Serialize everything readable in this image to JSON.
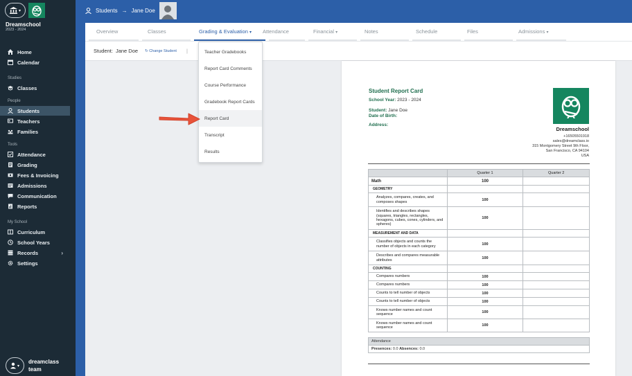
{
  "sidebar": {
    "school_name": "Dreamschool",
    "school_year": "2023 - 2024",
    "sections": {
      "studies": "Studies",
      "people": "People",
      "tools": "Tools",
      "my_school": "My School"
    },
    "items": [
      {
        "label": "Home",
        "icon": "home-icon"
      },
      {
        "label": "Calendar",
        "icon": "calendar-icon"
      },
      {
        "label": "Classes",
        "icon": "classes-icon"
      },
      {
        "label": "Students",
        "icon": "students-icon",
        "active": true
      },
      {
        "label": "Teachers",
        "icon": "teachers-icon"
      },
      {
        "label": "Families",
        "icon": "families-icon"
      },
      {
        "label": "Attendance",
        "icon": "attendance-icon"
      },
      {
        "label": "Grading",
        "icon": "grading-icon"
      },
      {
        "label": "Fees & Invoicing",
        "icon": "fees-icon"
      },
      {
        "label": "Admissions",
        "icon": "admissions-icon"
      },
      {
        "label": "Communication",
        "icon": "communication-icon"
      },
      {
        "label": "Reports",
        "icon": "reports-icon"
      },
      {
        "label": "Curriculum",
        "icon": "curriculum-icon"
      },
      {
        "label": "School Years",
        "icon": "school-years-icon"
      },
      {
        "label": "Records",
        "icon": "records-icon"
      },
      {
        "label": "Settings",
        "icon": "settings-icon"
      }
    ],
    "user": "dreamclass team"
  },
  "topbar": {
    "crumb_students": "Students",
    "crumb_arrow": "→",
    "crumb_student": "Jane Doe"
  },
  "tabs": [
    {
      "label": "Overview"
    },
    {
      "label": "Classes"
    },
    {
      "label": "Grading & Evaluation",
      "active": true
    },
    {
      "label": "Attendance"
    },
    {
      "label": "Financial"
    },
    {
      "label": "Notes"
    },
    {
      "label": "Schedule"
    },
    {
      "label": "Files"
    },
    {
      "label": "Admissions"
    }
  ],
  "student_row": {
    "label": "Student:",
    "name": "Jane Doe",
    "change": "Change Student"
  },
  "dropdown": [
    "Teacher Gradebooks",
    "Report Card Comments",
    "Course Performance",
    "Gradebook Report Cards",
    "Report Card",
    "Transcript",
    "Results"
  ],
  "report": {
    "title": "Student Report Card",
    "year_label": "School Year:",
    "year_value": "2023 - 2024",
    "student_label": "Student:",
    "student_value": "Jane Doe",
    "dob_label": "Date of Birth:",
    "address_label": "Address:",
    "school": "Dreamschool",
    "phone": "+16505501918",
    "email": "sales@dreamclass.io",
    "address1": "315 Montgomery Street 9th Floor,",
    "address2": "San Francisco, CA 94104",
    "country": "USA",
    "col_q1": "Quarter 1",
    "col_q2": "Quarter 2",
    "subject": "Math",
    "subject_value": "100",
    "rows": [
      {
        "type": "group",
        "label": "GEOMETRY"
      },
      {
        "type": "skill",
        "label": "Analyzes, compares, creates, and composes shapes",
        "value": "100"
      },
      {
        "type": "skill",
        "label": "Identifies and describes shapes (squares, triangles, rectangles, hexagons, cubes, cones, cylinders, and spheres)",
        "value": "100"
      },
      {
        "type": "group",
        "label": "MEASUREMENT AND DATA"
      },
      {
        "type": "skill",
        "label": "Classifies objects and counts the number of objects in each category",
        "value": "100"
      },
      {
        "type": "skill",
        "label": "Describes and compares measurable attributes",
        "value": "100"
      },
      {
        "type": "group",
        "label": "COUNTING"
      },
      {
        "type": "skill",
        "label": "Compares numbers",
        "value": "100"
      },
      {
        "type": "skill",
        "label": "Compares numbers",
        "value": "100"
      },
      {
        "type": "skill",
        "label": "Counts to tell number of objects",
        "value": "100"
      },
      {
        "type": "skill",
        "label": "Counts to tell number of objects",
        "value": "100"
      },
      {
        "type": "skill",
        "label": "Knows number names and count sequence",
        "value": "100"
      },
      {
        "type": "skill",
        "label": "Knows number names and count sequence",
        "value": "100"
      }
    ],
    "attendance_title": "Attendance",
    "presences_label": "Presences:",
    "presences_value": "0.0",
    "absences_label": "Absences:",
    "absences_value": "0.0"
  },
  "colors": {
    "brand_blue": "#2c5fa8",
    "sidebar": "#1c2b36",
    "green": "#15865f",
    "arrow": "#e8533a"
  }
}
